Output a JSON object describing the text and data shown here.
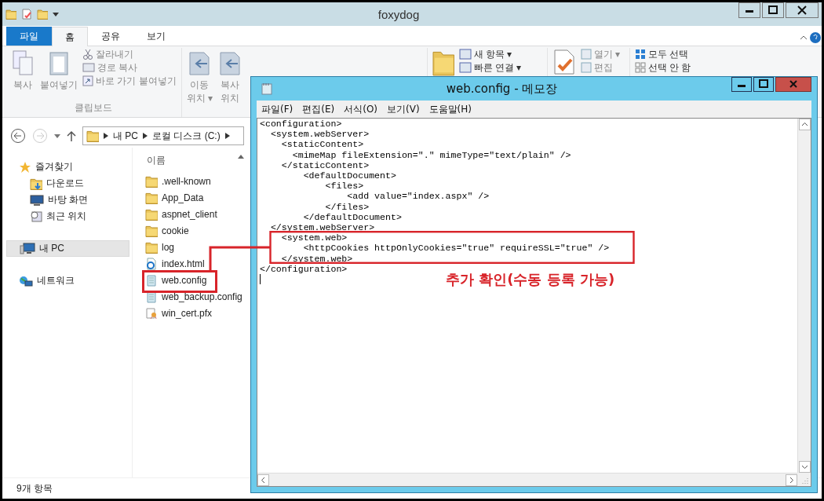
{
  "explorer": {
    "title": "foxydog",
    "tabs": [
      {
        "label": "파일",
        "kind": "file",
        "selected": false
      },
      {
        "label": "홈",
        "kind": "tab",
        "selected": true
      },
      {
        "label": "공유",
        "kind": "tab",
        "selected": false
      },
      {
        "label": "보기",
        "kind": "tab",
        "selected": false
      }
    ],
    "ribbon": {
      "clipboard": {
        "big": [
          "복사",
          "붙여넣기"
        ],
        "small": [
          "잘라내기",
          "경로 복사",
          "바로 가기 붙여넣기"
        ],
        "label": "클립보드"
      },
      "organize": [
        {
          "line1": "이동",
          "line2": "위치 ▾"
        },
        {
          "line1": "복사",
          "line2": "위치"
        }
      ],
      "new": [
        "새 항목 ▾",
        "빠른 연결 ▾"
      ],
      "open": [
        "열기 ▾",
        "편집"
      ],
      "select": [
        "모두 선택",
        "선택 안 함"
      ]
    },
    "path": [
      "내 PC",
      "로컬 디스크 (C:)"
    ],
    "sidebar": [
      {
        "label": "즐겨찾기",
        "kind": "star",
        "selected": false,
        "children": [
          {
            "label": "다운로드",
            "kind": "download",
            "selected": false
          },
          {
            "label": "바탕 화면",
            "kind": "desktop",
            "selected": false
          },
          {
            "label": "최근 위치",
            "kind": "recent",
            "selected": false
          }
        ]
      },
      {
        "label": "내 PC",
        "kind": "pc",
        "selected": true
      },
      {
        "label": "네트워크",
        "kind": "network",
        "selected": false
      }
    ],
    "column": "이름",
    "files": [
      {
        "name": ".well-known",
        "kind": "folder"
      },
      {
        "name": "App_Data",
        "kind": "folder"
      },
      {
        "name": "aspnet_client",
        "kind": "folder"
      },
      {
        "name": "cookie",
        "kind": "folder"
      },
      {
        "name": "log",
        "kind": "folder"
      },
      {
        "name": "index.html",
        "kind": "web"
      },
      {
        "name": "web.config",
        "kind": "config"
      },
      {
        "name": "web_backup.config",
        "kind": "config"
      },
      {
        "name": "win_cert.pfx",
        "kind": "cert"
      }
    ],
    "status_bar": "9개 항목"
  },
  "notepad": {
    "title": "web.config - 메모장",
    "menu": [
      "파일(F)",
      "편집(E)",
      "서식(O)",
      "보기(V)",
      "도움말(H)"
    ],
    "lines": [
      "<configuration>",
      "  <system.webServer>",
      "    <staticContent>",
      "      <mimeMap fileExtension=\".\" mimeType=\"text/plain\" />",
      "    </staticContent>",
      "        <defaultDocument>",
      "            <files>",
      "                <add value=\"index.aspx\" />",
      "            </files>",
      "        </defaultDocument>",
      "  </system.webServer>",
      "    <system.web>",
      "        <httpCookies httpOnlyCookies=\"true\" requireSSL=\"true\" />",
      "    </system.web>",
      "</configuration>"
    ]
  },
  "annotation": {
    "note": "추가 확인(수동 등록 가능)"
  }
}
